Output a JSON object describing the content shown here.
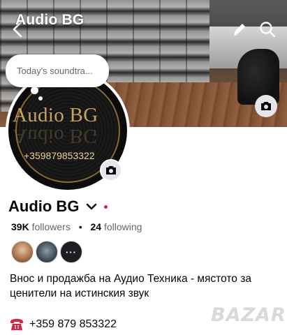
{
  "header": {
    "page_name": "Audio BG"
  },
  "note": {
    "text": "Today's soundtra..."
  },
  "avatar": {
    "brand_text": "Audio BG",
    "phone_text": "+359879853322"
  },
  "profile": {
    "name": "Audio BG",
    "followers_count": "39K",
    "followers_label": "followers",
    "separator": "•",
    "following_count": "24",
    "following_label": "following",
    "more_followers_label": "···",
    "bio": "Внос и продажба на Аудио Техника - мястото за ценители на истинския звук",
    "phone": "+359 879 853322"
  },
  "watermark": {
    "text": "BAZAR"
  },
  "icons": {
    "back": "back-arrow-icon",
    "edit": "pencil-icon",
    "search": "search-icon",
    "cover_camera": "camera-icon",
    "avatar_camera": "camera-icon",
    "chevron": "chevron-down-icon",
    "phone": "telephone-icon"
  },
  "colors": {
    "text_primary": "#050505",
    "text_secondary": "#65676b",
    "status_dot": "#e41e3f",
    "icon_bg": "#e4e6eb",
    "brand_gold": "#c8a45a"
  }
}
